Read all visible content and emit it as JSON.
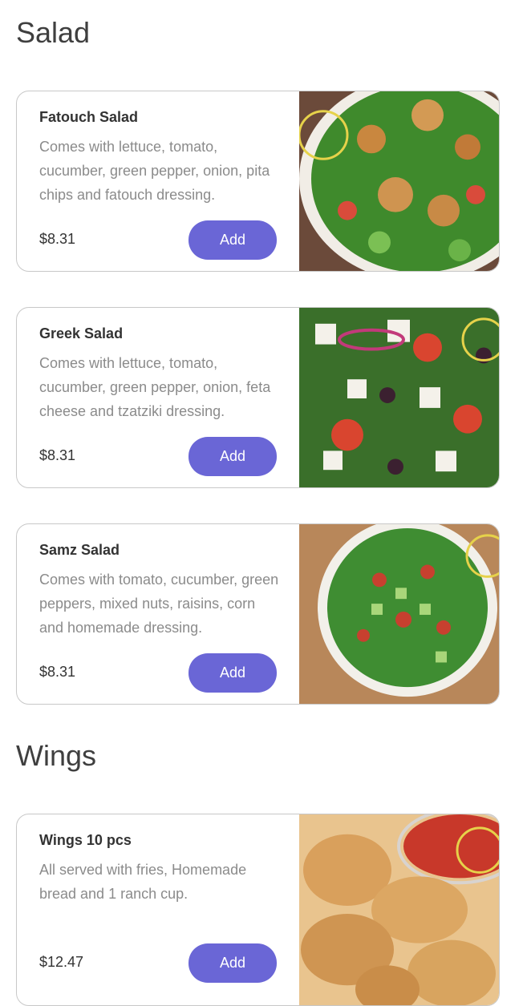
{
  "sections": [
    {
      "title": "Salad",
      "items": [
        {
          "name": "Fatouch Salad",
          "description": "Comes with lettuce, tomato, cucumber, green pepper, onion, pita chips and fatouch dressing.",
          "price": "$8.31",
          "add_label": "Add",
          "image_icon": "salad-photo"
        },
        {
          "name": "Greek Salad",
          "description": "Comes with lettuce, tomato, cucumber, green pepper, onion, feta cheese and tzatziki dressing.",
          "price": "$8.31",
          "add_label": "Add",
          "image_icon": "salad-photo"
        },
        {
          "name": "Samz Salad",
          "description": "Comes with tomato, cucumber, green peppers, mixed nuts, raisins, corn and homemade dressing.",
          "price": "$8.31",
          "add_label": "Add",
          "image_icon": "salad-photo"
        }
      ]
    },
    {
      "title": "Wings",
      "items": [
        {
          "name": "Wings 10 pcs",
          "description": "All served with fries, Homemade bread and 1 ranch cup.",
          "price": "$12.47",
          "add_label": "Add",
          "image_icon": "wings-photo"
        }
      ]
    }
  ],
  "colors": {
    "accent": "#6a66d6",
    "text": "#333333",
    "muted": "#8b8b8b",
    "border": "#c8c8c8"
  }
}
